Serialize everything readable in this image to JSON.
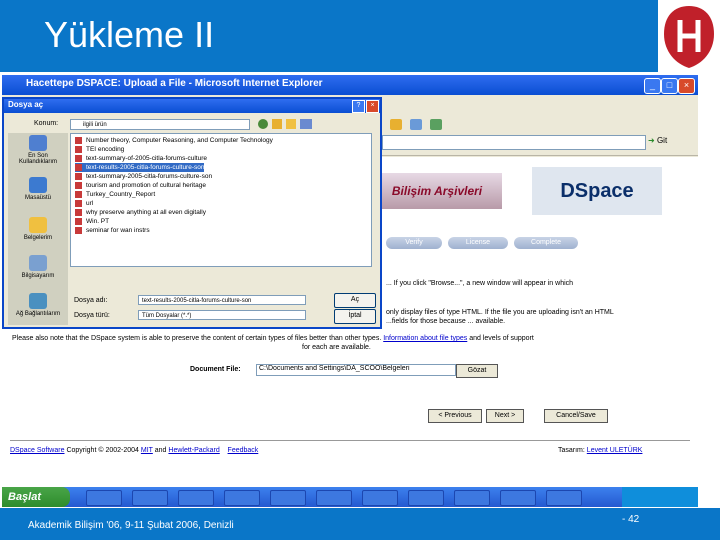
{
  "slide": {
    "title": "Yükleme II",
    "footer": "Akademik Bilişim '06, 9-11 Şubat 2006, Denizli",
    "page": "- 42",
    "colors": {
      "header": "#0a76c8",
      "title_text": "#ffffff"
    }
  },
  "browser": {
    "title": "Hacettepe DSPACE: Upload a File - Microsoft Internet Explorer",
    "go_label": "Git"
  },
  "page": {
    "banner_text": "Bilişim Arşivleri",
    "logo_text": "DSpace",
    "steps": [
      "Verify",
      "License",
      "Complete"
    ],
    "line1": "... If you click \"Browse...\", a new window will appear in which",
    "line2": "only display files of type HTML. If the file you are uploading isn't an HTML",
    "line3": "...fields for those because ... available.",
    "note_prefix": "Please also note that the DSpace system is able to preserve the content of certain types of files better than other types.",
    "note_link": "Information about file types",
    "note_suffix": "and levels of support",
    "note_line2": "for each are available.",
    "doc_label": "Document File:",
    "doc_value": "C:\\Documents and Settings\\DA_SCOO\\Belgeleri",
    "browse_btn": "Gözat",
    "prev_btn": "< Previous",
    "next_btn": "Next >",
    "cancel_btn": "Cancel/Save",
    "footer_link1": "DSpace Software",
    "footer_copy": "Copyright © 2002-2004",
    "footer_link2": "MIT",
    "footer_and": "and",
    "footer_link3": "Hewlett-Packard",
    "footer_link4": "Feedback",
    "footer_right_prefix": "Tasarım:",
    "footer_right_link": "Levent ULETÜRK"
  },
  "dialog": {
    "title": "Dosya aç",
    "look_in_label": "Konum:",
    "look_in_value": "ilgili ürün",
    "places": [
      "En Son Kullandıklarım",
      "Masaüstü",
      "Belgelerim",
      "Bilgisayarım",
      "Ağ Bağlantılarım"
    ],
    "files": [
      "Number theory, Computer Reasoning, and Computer Technology",
      "TEI encoding",
      "text-summary-of-2005-citla-forums-culture",
      "text-results-2005-citla-forums-culture-son",
      "text-summary-2005-citla-forums-culture-son",
      "tourism and promotion of cultural heritage",
      "Turkey_Country_Report",
      "url",
      "why preserve anything at all even digitally",
      "Win. PT",
      "seminar for wan instrs"
    ],
    "selected_index": 3,
    "file_name_label": "Dosya adı:",
    "file_name_value": "text-results-2005-citla-forums-culture-son",
    "file_type_label": "Dosya türü:",
    "file_type_value": "Tüm Dosyalar (*.*)",
    "open_btn": "Aç",
    "cancel_btn": "İptal"
  },
  "taskbar": {
    "start_label": "Başlat"
  }
}
